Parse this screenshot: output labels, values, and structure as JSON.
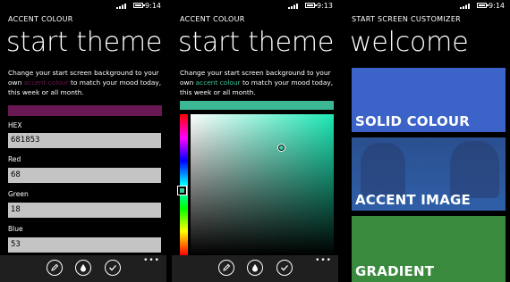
{
  "status_bar": [
    {
      "time": "9:14"
    },
    {
      "time": "9:13"
    },
    {
      "time": "9:14"
    }
  ],
  "screen1": {
    "app_title": "ACCENT COLOUR",
    "page_title": "start theme",
    "desc_pre": "Change your start screen background to your own ",
    "desc_link": "accent colour",
    "desc_post": " to match your mood today, this week or all month.",
    "link_color": "#681853",
    "swatch_color": "#681853",
    "fields": [
      {
        "label": "HEX",
        "value": "681853"
      },
      {
        "label": "Red",
        "value": "68"
      },
      {
        "label": "Green",
        "value": "18"
      },
      {
        "label": "Blue",
        "value": "53"
      }
    ]
  },
  "screen2": {
    "app_title": "ACCENT COLOUR",
    "page_title": "start theme",
    "desc_pre": "Change your start screen background to your own ",
    "desc_link": "accent colour",
    "desc_post": " to match your mood today, this week or all month.",
    "link_color": "#3cc8a0",
    "swatch_color": "#3cb796"
  },
  "screen3": {
    "app_title": "START SCREEN CUSTOMIZER",
    "page_title": "welcome",
    "tiles": [
      {
        "label": "SOLID COLOUR",
        "color": "#3c63c8"
      },
      {
        "label": "ACCENT IMAGE",
        "color": "#2f5fa8"
      },
      {
        "label": "GRADIENT",
        "color": "#3a8a3e"
      }
    ]
  },
  "appbar": {
    "icons": [
      "edit-icon",
      "drop-icon",
      "check-icon"
    ],
    "more_label": "•••"
  }
}
